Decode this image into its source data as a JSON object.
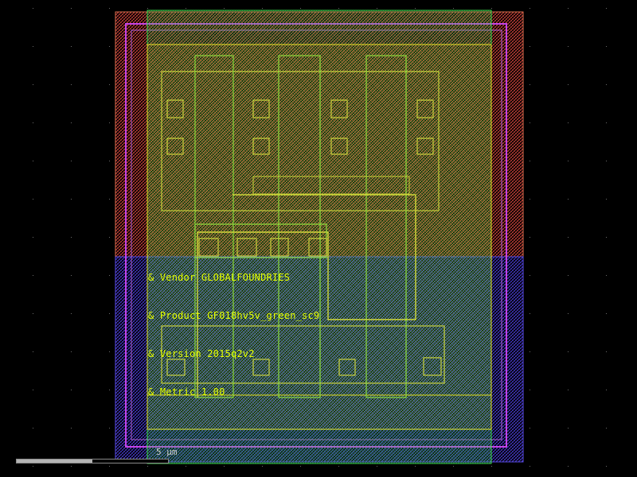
{
  "labels": {
    "vendor": "& Vendor GLOBALFOUNDRIES",
    "product": "& Product GF018hv5v_green_sc9",
    "version": "& Version 2015q2v2",
    "metric": "& Metric 1.00"
  },
  "scale": {
    "text": "5 µm",
    "progress": 0.5
  },
  "colors": {
    "background": "#000000",
    "label_text": "#e6ff00",
    "nwell_red": "#d2443c",
    "pwell_blue": "#4a3cd8",
    "implant_magenta": "#c444e6",
    "active_green": "#3cdc50",
    "metal_yellow": "#e6e628",
    "poly_orange": "#d48a4a"
  }
}
